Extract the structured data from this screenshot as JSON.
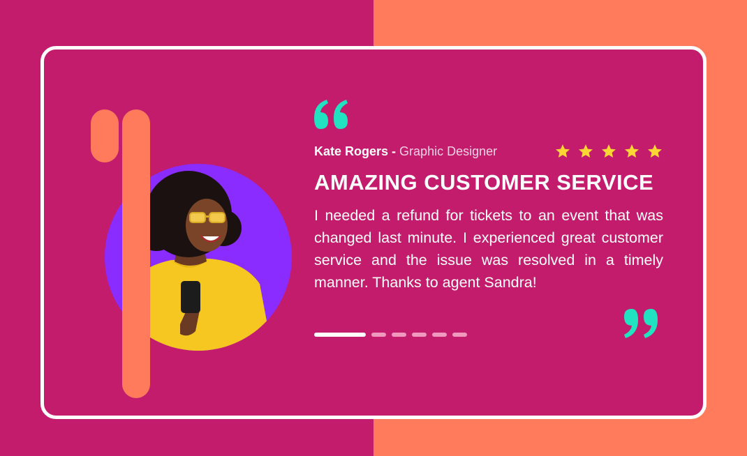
{
  "colors": {
    "background_left": "#c41c6c",
    "background_right": "#ff7b5c",
    "card": "#c41c6c",
    "accent_bar": "#ff7b5c",
    "circle": "#8a2bff",
    "quote": "#22e3c1",
    "star": "#ffd633"
  },
  "testimonial": {
    "author_name": "Kate Rogers -",
    "author_role": "Graphic Designer",
    "rating": 5,
    "title": "AMAZING CUSTOMER SERVICE",
    "body": "I needed a refund for tickets to an event that was changed last minute. I experienced great customer service and the issue was resolved in a timely manner. Thanks to agent Sandra!"
  },
  "icons": {
    "open_quote": "open-quote-icon",
    "close_quote": "close-quote-icon",
    "star": "star-icon"
  },
  "carousel": {
    "total": 6,
    "active_index": 0
  }
}
